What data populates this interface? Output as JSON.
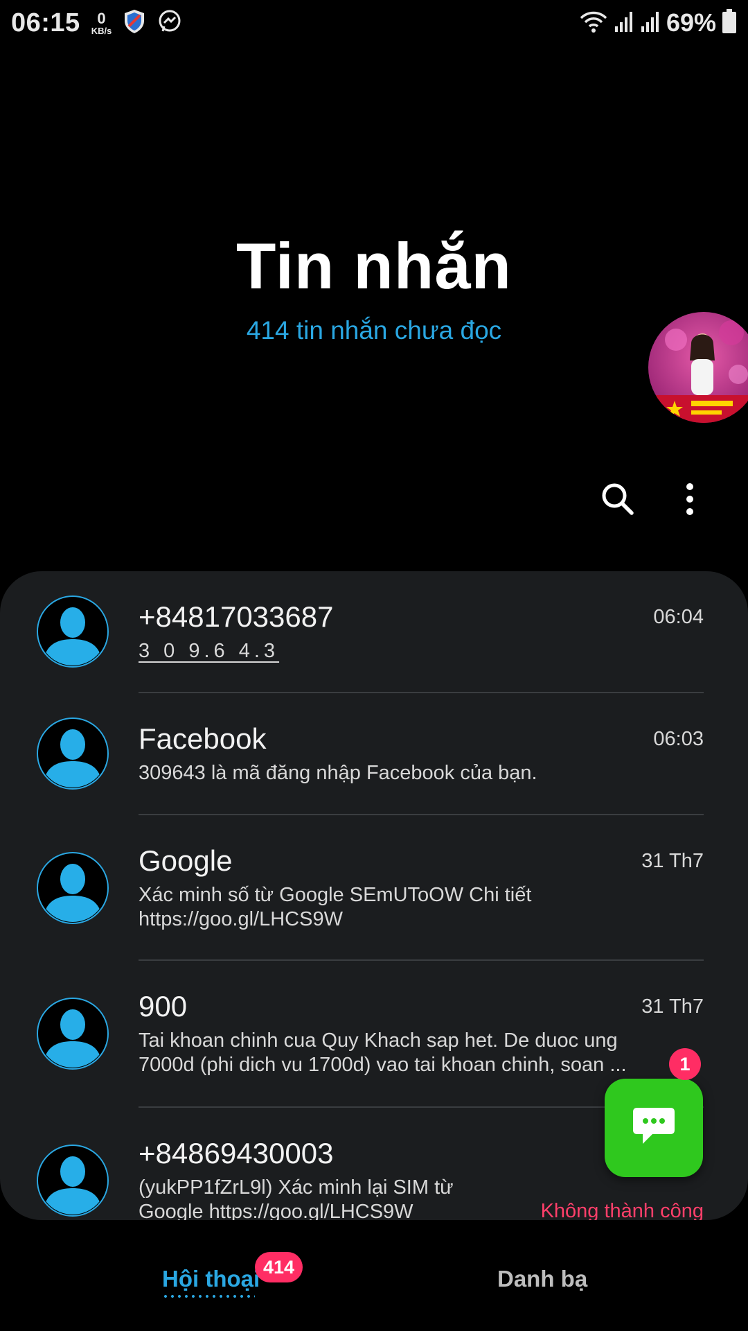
{
  "status_bar": {
    "time": "06:15",
    "net_speed_value": "0",
    "net_speed_unit": "KB/s",
    "battery_percent": "69%",
    "icons": [
      "shield-app-icon",
      "messenger-icon",
      "wifi-icon",
      "signal-icon",
      "signal-icon",
      "battery-icon"
    ]
  },
  "header": {
    "title": "Tin nhắn",
    "subtitle": "414 tin nhắn chưa đọc"
  },
  "toolbar": {
    "icons": [
      "search-icon",
      "more-vert-icon"
    ]
  },
  "conversations": [
    {
      "name": "+84817033687",
      "time": "06:04",
      "preview": "3 0 9.6 4.3"
    },
    {
      "name": "Facebook",
      "time": "06:03",
      "preview": "309643 là mã đăng nhập Facebook của bạn."
    },
    {
      "name": "Google",
      "time": "31 Th7",
      "preview_line1": "Xác minh số từ Google SEmUToOW Chi tiết",
      "preview_line2": "https://goo.gl/LHCS9W"
    },
    {
      "name": "900",
      "time": "31 Th7",
      "preview_line1": "Tai khoan chinh cua Quy Khach sap het. De duoc ung",
      "preview_line2": "7000d (phi dich vu 1700d) vao tai khoan chinh, soan ..."
    },
    {
      "name": "+84869430003",
      "status": "Không thành công",
      "preview_line1": "(yukPP1fZrL9l) Xác minh lại SIM từ",
      "preview_line2": "Google https://goo.gl/LHCS9W"
    }
  ],
  "fab": {
    "badge": "1",
    "icon": "chat-bubble-icon"
  },
  "bottom_nav": {
    "tabs": [
      {
        "label": "Hội thoại",
        "badge": "414",
        "active": true
      },
      {
        "label": "Danh bạ",
        "active": false
      }
    ]
  },
  "colors": {
    "accent": "#2aa7e2",
    "badge": "#ff2d64",
    "fab": "#2fc81e",
    "panel": "#1b1d1f",
    "error": "#ff3f6a"
  }
}
